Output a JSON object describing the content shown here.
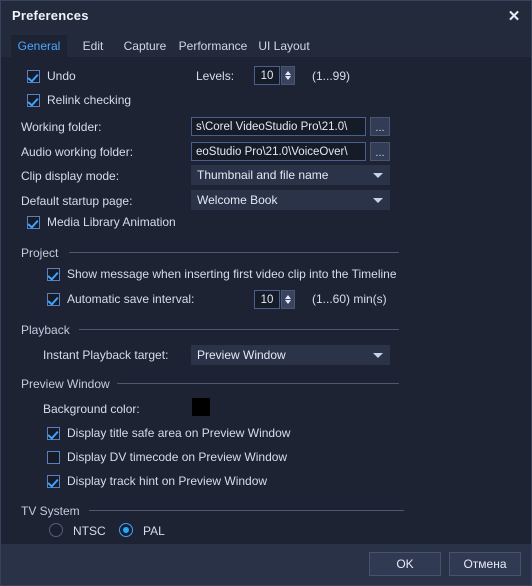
{
  "window": {
    "title": "Preferences",
    "close_icon": "close-icon"
  },
  "tabs": [
    {
      "label": "General",
      "active": true
    },
    {
      "label": "Edit",
      "active": false
    },
    {
      "label": "Capture",
      "active": false
    },
    {
      "label": "Performance",
      "active": false
    },
    {
      "label": "UI Layout",
      "active": false
    }
  ],
  "general": {
    "undo_label": "Undo",
    "levels_label": "Levels:",
    "levels_value": "10",
    "levels_range": "(1...99)",
    "relink_label": "Relink checking",
    "working_folder_label": "Working folder:",
    "working_folder_value": "s\\Corel VideoStudio Pro\\21.0\\",
    "audio_folder_label": "Audio working folder:",
    "audio_folder_value": "eoStudio Pro\\21.0\\VoiceOver\\",
    "browse_label": "...",
    "clip_display_label": "Clip display mode:",
    "clip_display_value": "Thumbnail and file name",
    "startup_page_label": "Default startup page:",
    "startup_page_value": "Welcome Book",
    "media_library_label": "Media Library Animation"
  },
  "project": {
    "group_title": "Project",
    "show_message_label": "Show message when inserting first video clip into the Timeline",
    "autosave_label": "Automatic save interval:",
    "autosave_value": "10",
    "autosave_range": "(1...60) min(s)"
  },
  "playback": {
    "group_title": "Playback",
    "instant_target_label": "Instant Playback target:",
    "instant_target_value": "Preview Window"
  },
  "preview": {
    "group_title": "Preview Window",
    "background_color_label": "Background color:",
    "background_color_value": "#000000",
    "title_safe_label": "Display title safe area on Preview Window",
    "dv_timecode_label": "Display DV timecode on Preview Window",
    "track_hint_label": "Display track hint on Preview Window"
  },
  "tv_system": {
    "group_title": "TV System",
    "ntsc_label": "NTSC",
    "pal_label": "PAL",
    "selected": "PAL"
  },
  "footer": {
    "ok_label": "OK",
    "cancel_label": "Отмена"
  },
  "colors": {
    "accent": "#4da6ff",
    "dialog_bg": "#1d2333",
    "titlebar_bg": "#222a3c",
    "footer_bg": "#2a3247"
  }
}
